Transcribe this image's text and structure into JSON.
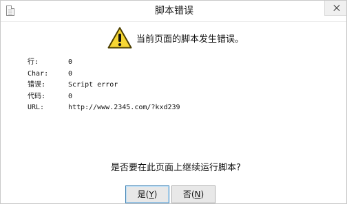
{
  "window": {
    "title": "脚本错误",
    "app_icon": "document-icon",
    "close_icon": "close-icon"
  },
  "dialog": {
    "icon": "warning-icon",
    "message": "当前页面的脚本发生错误。",
    "details": [
      {
        "label": "行:",
        "value": "0"
      },
      {
        "label": "Char:",
        "value": "0"
      },
      {
        "label": "错误:",
        "value": "Script error"
      },
      {
        "label": "代码:",
        "value": "0"
      },
      {
        "label": "URL:",
        "value": "http://www.2345.com/?kxd239"
      }
    ],
    "question": "是否要在此页面上继续运行脚本?"
  },
  "buttons": {
    "yes_label": "是",
    "yes_key": "Y",
    "no_label": "否",
    "no_key": "N"
  },
  "colors": {
    "warning_fill": "#f7d733",
    "warning_stroke": "#5a4a00",
    "default_button_border": "#3c7fb1"
  }
}
